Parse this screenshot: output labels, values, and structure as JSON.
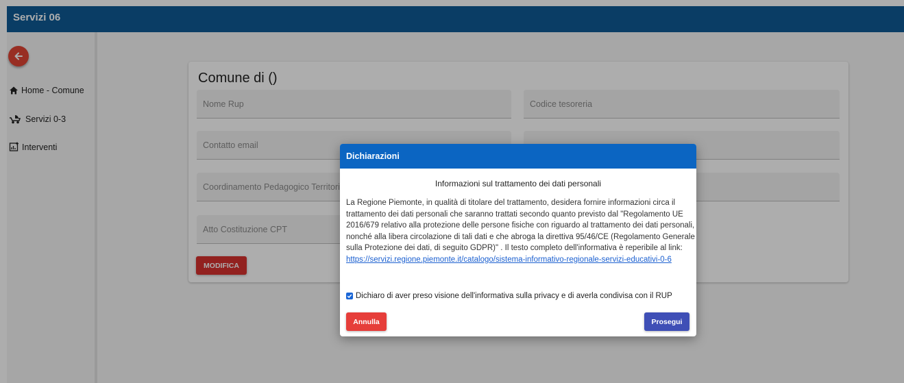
{
  "app": {
    "title": "Servizi 06"
  },
  "sidebar": {
    "back_icon": "arrow-left-icon",
    "items": [
      {
        "label": "Home - Comune",
        "icon": "home-icon"
      },
      {
        "label": "Servizi 0-3",
        "icon": "stroller-icon"
      },
      {
        "label": "Interventi",
        "icon": "chart-add-icon"
      }
    ]
  },
  "card": {
    "title": "Comune di ()",
    "fields": {
      "nome_rup": "Nome Rup",
      "codice_tesoreria": "Codice tesoreria",
      "contatto_email": "Contatto email",
      "coordinamento": "Coordinamento Pedagogico Territoriale",
      "atto": "Atto Costituzione CPT"
    },
    "modifica_label": "MODIFICA"
  },
  "modal": {
    "title": "Dichiarazioni",
    "subtitle": "Informazioni sul trattamento dei dati personali",
    "body": "La Regione Piemonte, in qualità di titolare del trattamento, desidera fornire informazioni circa il trattamento dei dati personali che saranno trattati secondo quanto previsto dal \"Regolamento UE 2016/679 relativo alla protezione delle persone fisiche con riguardo al trattamento dei dati personali, nonché alla libera circolazione di tali dati e che abroga la direttiva 95/46/CE (Regolamento Generale sulla Protezione dei dati, di seguito GDPR)\" . Il testo completo dell'informativa è reperibile al link: ",
    "link": "https://servizi.regione.piemonte.it/catalogo/sistema-informativo-regionale-servizi-educativi-0-6",
    "consent_label": "Dichiaro di aver preso visione dell'informativa sulla privacy e di averla condivisa con il RUP",
    "consent_checked": true,
    "cancel_label": "Annulla",
    "continue_label": "Prosegui"
  },
  "colors": {
    "topbar": "#0f5a96",
    "modal_header": "#0b65c2",
    "danger": "#e63e3a",
    "primary": "#3f4fb6"
  }
}
